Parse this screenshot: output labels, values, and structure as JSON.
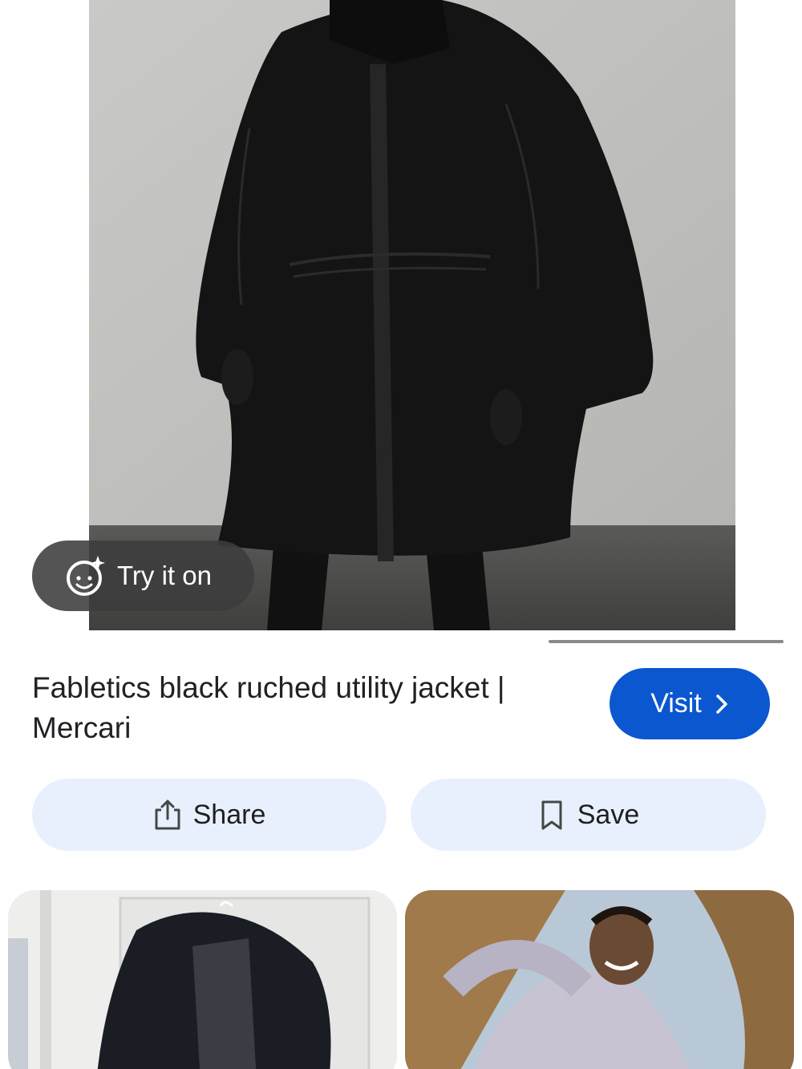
{
  "product": {
    "title": "Fabletics black ruched utility jacket | Mercari",
    "image_alt": "Model wearing black ruched utility jacket"
  },
  "try_on": {
    "label": "Try it on",
    "icon": "face-sparkle-icon"
  },
  "actions": {
    "visit_label": "Visit",
    "share_label": "Share",
    "save_label": "Save"
  },
  "icons": {
    "visit": "chevron-right-icon",
    "share": "share-icon",
    "save": "bookmark-icon"
  },
  "colors": {
    "visit_bg": "#0b57d0",
    "action_bg": "#e8f0fe",
    "try_on_bg": "#3c3c3c",
    "text": "#202124"
  },
  "related": [
    {
      "name": "Black jacket on hanger"
    },
    {
      "name": "Woman in lilac jacket outdoors"
    }
  ]
}
